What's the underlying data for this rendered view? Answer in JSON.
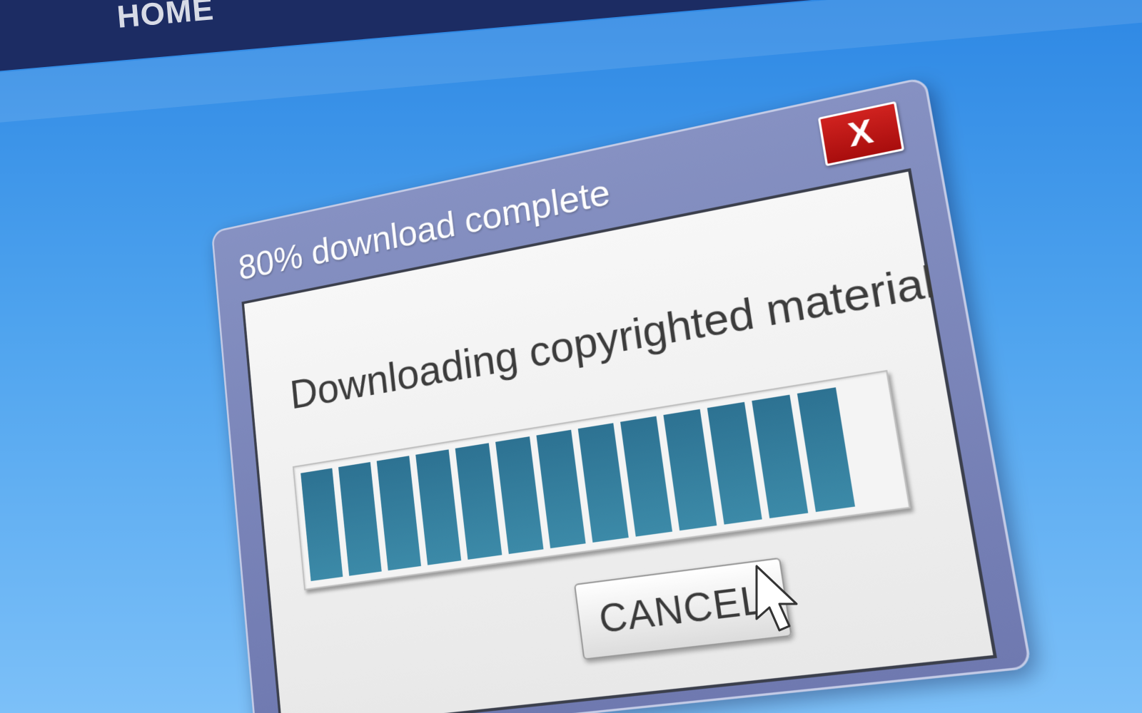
{
  "nav": {
    "home_label": "HOME"
  },
  "dialog": {
    "title": "80% download complete",
    "close_label": "X",
    "message": "Downloading copyrighted material",
    "progress": {
      "fraction": 0.8,
      "segments_filled": 13
    },
    "cancel_label": "CANCEL"
  },
  "colors": {
    "background": "#2e88e4",
    "navbar": "#1c2c63",
    "dialog_frame": "#7a84ba",
    "close_button": "#c21b18",
    "progress_segment": "#2d7292"
  },
  "icons": {
    "close": "close-icon",
    "cursor": "mouse-pointer-icon"
  }
}
